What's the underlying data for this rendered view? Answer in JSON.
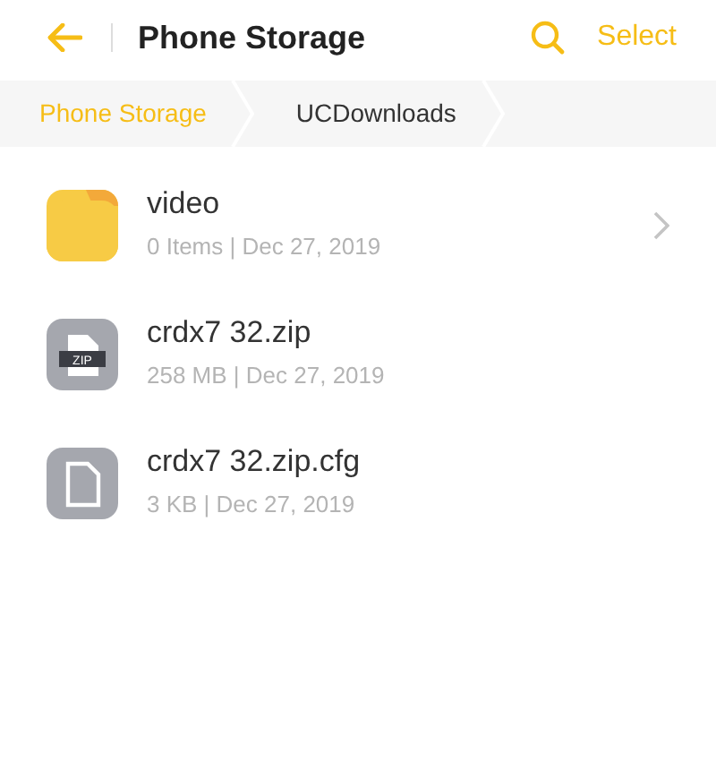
{
  "header": {
    "title": "Phone Storage",
    "action": "Select"
  },
  "breadcrumbs": [
    {
      "label": "Phone Storage",
      "current": false
    },
    {
      "label": "UCDownloads",
      "current": true
    }
  ],
  "files": [
    {
      "kind": "folder",
      "name": "video",
      "meta": "0 Items | Dec 27, 2019"
    },
    {
      "kind": "zip",
      "name": "crdx7 32.zip",
      "meta": "258 MB | Dec 27, 2019",
      "badge": "ZIP"
    },
    {
      "kind": "file",
      "name": "crdx7 32.zip.cfg",
      "meta": "3 KB | Dec 27, 2019"
    }
  ]
}
